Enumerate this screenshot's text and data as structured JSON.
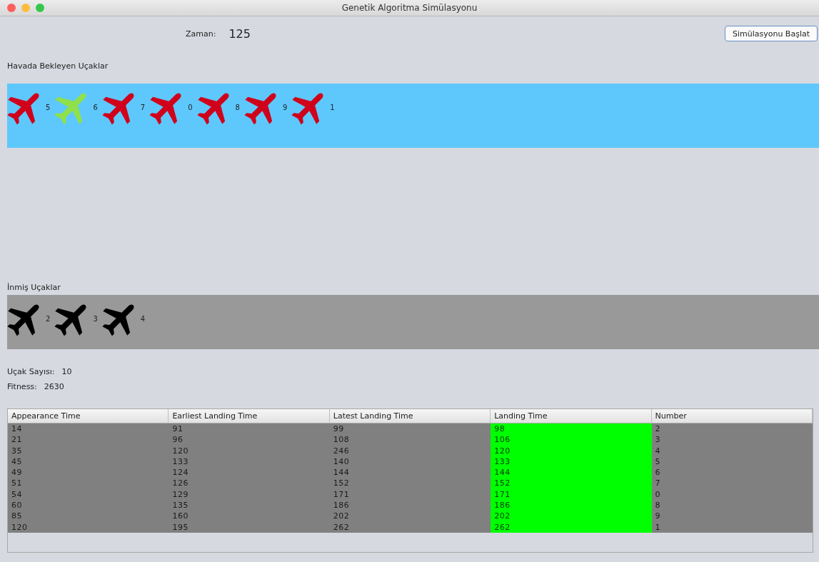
{
  "window": {
    "title": "Genetik Algoritma Simülasyonu"
  },
  "time": {
    "label": "Zaman:",
    "value": "125"
  },
  "start_button": "Simülasyonu Başlat",
  "waiting": {
    "title": "Havada Bekleyen Uçaklar",
    "planes": [
      {
        "number": "5",
        "color": "#d0021b"
      },
      {
        "number": "6",
        "color": "#8fe04a"
      },
      {
        "number": "7",
        "color": "#d0021b"
      },
      {
        "number": "0",
        "color": "#d0021b"
      },
      {
        "number": "8",
        "color": "#d0021b"
      },
      {
        "number": "9",
        "color": "#d0021b"
      },
      {
        "number": "1",
        "color": "#d0021b"
      }
    ]
  },
  "landed": {
    "title": "İnmiş Uçaklar",
    "planes": [
      {
        "number": "2"
      },
      {
        "number": "3"
      },
      {
        "number": "4"
      }
    ]
  },
  "stats": [
    {
      "label": "Uçak Sayısı:",
      "value": "10"
    },
    {
      "label": "Fitness:",
      "value": "2630"
    }
  ],
  "table": {
    "columns": [
      {
        "label": "Appearance Time",
        "highlighted": false
      },
      {
        "label": "Earliest Landing Time",
        "highlighted": false
      },
      {
        "label": "Latest Landing Time",
        "highlighted": false
      },
      {
        "label": "Landing Time",
        "highlighted": true
      },
      {
        "label": "Number",
        "highlighted": false
      }
    ],
    "rows": [
      [
        "14",
        "91",
        "99",
        "98",
        "2"
      ],
      [
        "21",
        "96",
        "108",
        "106",
        "3"
      ],
      [
        "35",
        "120",
        "246",
        "120",
        "4"
      ],
      [
        "45",
        "133",
        "140",
        "133",
        "5"
      ],
      [
        "49",
        "124",
        "144",
        "144",
        "6"
      ],
      [
        "51",
        "126",
        "152",
        "152",
        "7"
      ],
      [
        "54",
        "129",
        "171",
        "171",
        "0"
      ],
      [
        "60",
        "135",
        "186",
        "186",
        "8"
      ],
      [
        "85",
        "160",
        "202",
        "202",
        "9"
      ],
      [
        "120",
        "195",
        "262",
        "262",
        "1"
      ]
    ]
  }
}
